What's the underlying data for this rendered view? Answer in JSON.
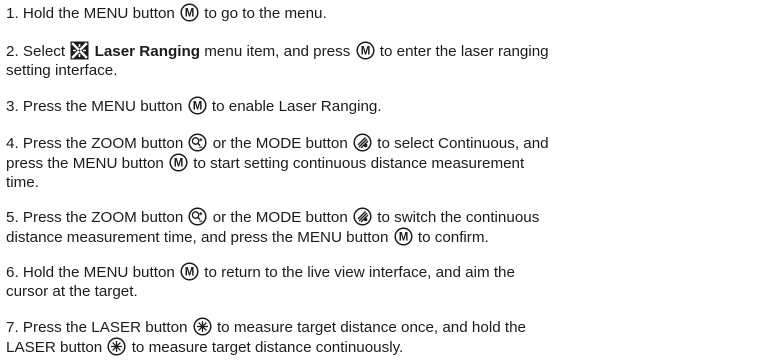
{
  "steps": [
    {
      "l1a": "1. Hold the MENU button ",
      "l1b": " to go to the menu."
    },
    {
      "l1a": "2. Select ",
      "item": "Laser Ranging",
      "l1b": " menu item, and press ",
      "l1c": " to enter the laser ranging",
      "l2": "setting interface."
    },
    {
      "l1a": "3. Press the MENU button ",
      "l1b": " to enable Laser Ranging."
    },
    {
      "l1a": "4. Press the ZOOM button ",
      "l1b": " or the MODE button ",
      "l1c": " to select Continuous, and",
      "l2a": "press the MENU button ",
      "l2b": " to start setting continuous distance measurement",
      "l3": "time."
    },
    {
      "l1a": "5. Press the ZOOM button ",
      "l1b": " or the MODE button ",
      "l1c": " to switch the continuous",
      "l2a": "distance measurement time, and press the MENU button ",
      "l2b": " to confirm."
    },
    {
      "l1a": "6. Hold the MENU button ",
      "l1b": " to return to the live view interface, and aim the",
      "l2": "cursor at the target."
    },
    {
      "l1a": "7. Press the LASER button ",
      "l1b": " to measure target distance once, and hold the",
      "l2a": "LASER button ",
      "l2b": " to measure target distance continuously."
    }
  ],
  "icons": {
    "menu": "menu-button-icon",
    "zoom": "zoom-button-icon",
    "mode": "mode-button-icon",
    "laser": "laser-button-icon",
    "laser_ranging": "laser-ranging-icon"
  }
}
